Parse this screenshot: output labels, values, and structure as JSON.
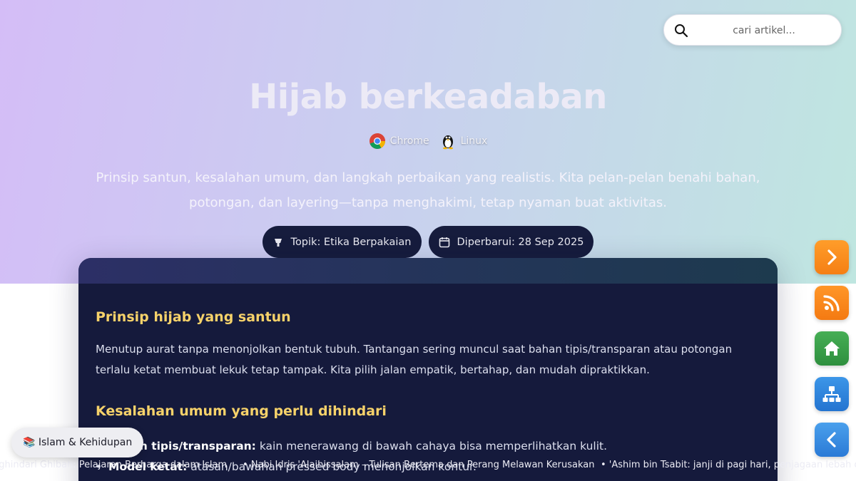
{
  "search": {
    "placeholder": "cari artikel..."
  },
  "hero": {
    "title": "Hijab berkeadaban",
    "platforms": [
      {
        "label": "Chrome",
        "icon": "chrome-icon"
      },
      {
        "label": "Linux",
        "icon": "linux-tux-icon"
      }
    ],
    "subtitle": "Prinsip santun, kesalahan umum, dan langkah perbaikan yang realistis. Kita pelan-pelan benahi bahan, potongan, dan layering—tanpa menghakimi, tetap nyaman buat aktivitas.",
    "meta": {
      "topic": "Topik: Etika Berpakaian",
      "topic_icon": "hanger-icon",
      "updated": "Diperbarui: 28 Sep 2025",
      "updated_icon": "calendar-icon"
    }
  },
  "article": {
    "section1_title": "Prinsip hijab yang santun",
    "section1_body": "Menutup aurat tanpa menonjolkan bentuk tubuh. Tantangan sering muncul saat bahan tipis/transparan atau potongan terlalu ketat membuat lekuk tetap tampak. Kita pilih jalan empatik, bertahap, dan mudah dipraktikkan.",
    "section2_title": "Kesalahan umum yang perlu dihindari",
    "items": [
      {
        "bold": "Bahan tipis/transparan:",
        "text": " kain menerawang di bawah cahaya bisa memperlihatkan kulit."
      },
      {
        "bold": "Model ketat:",
        "text": " atasan/bawahan pressed body menonjolkan kontur."
      }
    ]
  },
  "ticker": {
    "item1": "nghindari Ghibah: Pelajaran Berharga dalam Islam",
    "item2": "• Nabi Idris 'Alaihissalam – Tulisan Bertema dan Perang Melawan Kerusakan",
    "item3": "• 'Ashim bin Tsabit: janji di pagi hari, penjagaan lebah dan tubuh"
  },
  "category_badge": {
    "label": "📚 Islam & Kehidupan"
  },
  "side_buttons": [
    {
      "name": "next-button",
      "icon": "chevron-right-icon",
      "color": "#f7861c"
    },
    {
      "name": "rss-button",
      "icon": "rss-icon",
      "color": "#f5821a"
    },
    {
      "name": "home-button",
      "icon": "home-icon",
      "color": "#3a9e48"
    },
    {
      "name": "sitemap-button",
      "icon": "sitemap-icon",
      "color": "#2f82dc"
    },
    {
      "name": "back-button",
      "icon": "chevron-left-icon",
      "color": "#3389e0"
    }
  ]
}
